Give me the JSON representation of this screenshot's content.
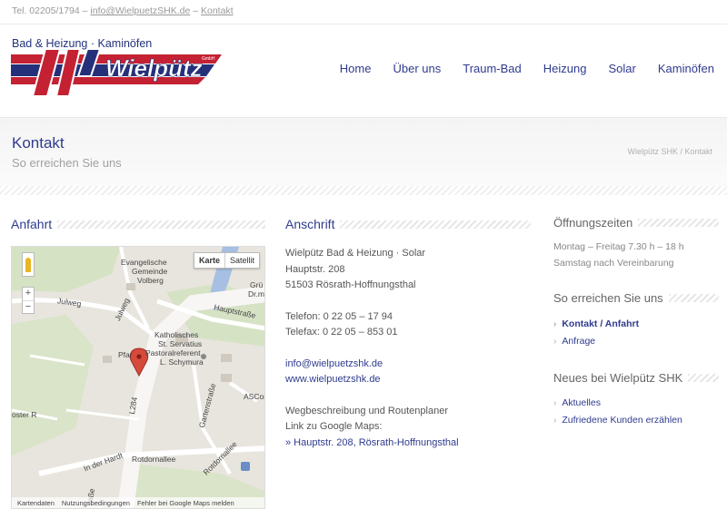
{
  "topbar": {
    "phone": "Tel. 02205/1794",
    "sep1": " – ",
    "email": "info@WielpuetzSHK.de",
    "sep2": " – ",
    "contact": "Kontakt"
  },
  "logo": {
    "tagline": "Bad & Heizung · Kaminöfen",
    "name": "Wielpütz",
    "suffix": "GmbH",
    "colors": {
      "red": "#c42133",
      "blue": "#24317a"
    }
  },
  "nav": [
    "Home",
    "Über uns",
    "Traum-Bad",
    "Heizung",
    "Solar",
    "Kaminöfen"
  ],
  "page": {
    "title": "Kontakt",
    "subtitle": "So erreichen Sie uns",
    "breadcrumb": "Wielpütz SHK / Kontakt"
  },
  "anfahrt": {
    "heading": "Anfahrt",
    "map": {
      "btn_map": "Karte",
      "btn_sat": "Satellit",
      "zoom_in": "+",
      "zoom_out": "−",
      "labels": {
        "church": "Evangelische",
        "church2": "Gemeinde",
        "church3": "Volberg",
        "julweg": "Julweg",
        "julweg2": "Julweg",
        "hauptstr": "Hauptstraße",
        "katholisch": "Katholisches",
        "servatius": "St. Servatius",
        "pastoral": "Pastoralreferent",
        "schymura": "L. Schymura",
        "pfar": "Pfar",
        "l284": "L284",
        "gartenstr": "Gartenstraße",
        "rotdorn": "Rotdornallee",
        "rotdorn2": "Rotdornallee",
        "inderhardt": "In der Hardt",
        "asco": "ASCon",
        "gru": "Grü",
        "drme": "Dr.me",
        "ostr": "oster R",
        "strasse": "raße"
      },
      "footer": [
        "Kartendaten",
        "Nutzungsbedingungen",
        "Fehler bei Google Maps melden"
      ]
    }
  },
  "anschrift": {
    "heading": "Anschrift",
    "company": "Wielpütz Bad & Heizung · Solar",
    "street": "Hauptstr. 208",
    "city": "51503 Rösrath-Hoffnungsthal",
    "telefon": "Telefon: 0 22 05 – 17 94",
    "telefax": "Telefax: 0 22 05 – 853 01",
    "email": "info@wielpuetzshk.de",
    "web": "www.wielpuetzshk.de",
    "route1": "Wegbeschreibung und Routenplaner",
    "route2": "Link zu Google Maps:",
    "maplink": "» Hauptstr. 208, Rösrath-Hoffnungsthal"
  },
  "sidebar": {
    "hours_heading": "Öffnungszeiten",
    "hours1": "Montag – Freitag 7.30 h – 18 h",
    "hours2": "Samstag nach Vereinbarung",
    "reach_heading": "So erreichen Sie uns",
    "reach_links": [
      "Kontakt / Anfahrt",
      "Anfrage"
    ],
    "news_heading": "Neues bei Wielpütz SHK",
    "news_links": [
      "Aktuelles",
      "Zufriedene Kunden erzählen"
    ]
  }
}
